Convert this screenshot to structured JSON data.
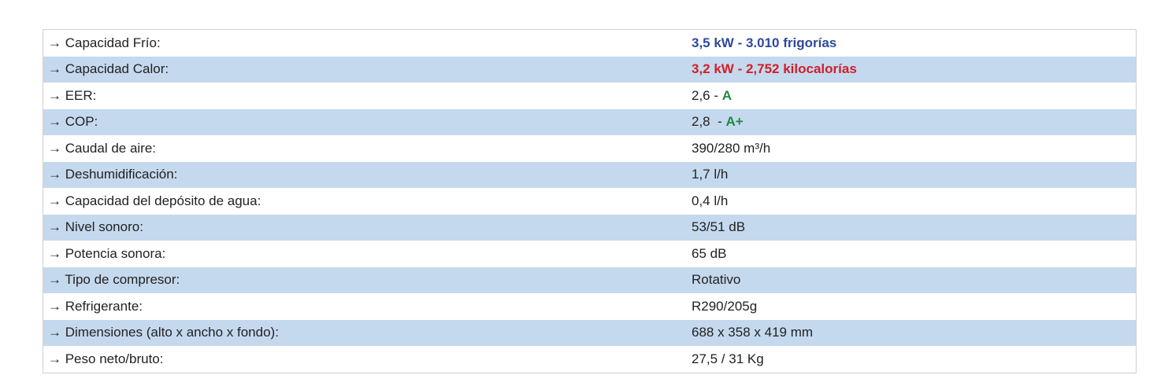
{
  "colors": {
    "blue": "#2f4a9a",
    "red": "#d01f2a",
    "green": "#1f8a45",
    "row_alt": "#c5d9ee"
  },
  "rows": [
    {
      "label": "→ Capacidad Frío:",
      "value": "3,5 kW - 3.010 frigorías"
    },
    {
      "label": "→ Capacidad Calor:",
      "value": "3,2 kW - 2,752 kilocalorías"
    },
    {
      "label": "→ EER:",
      "value": "2,6 - ",
      "rating": "A"
    },
    {
      "label": "→ COP:",
      "value": "2,8  - ",
      "rating": "A+"
    },
    {
      "label": "→ Caudal de aire:",
      "value": "390/280 m³/h"
    },
    {
      "label": "→ Deshumidificación:",
      "value": "1,7 l/h"
    },
    {
      "label": "→ Capacidad del depósito de agua:",
      "value": "0,4 l/h"
    },
    {
      "label": "→ Nivel sonoro:",
      "value": "53/51 dB"
    },
    {
      "label": "→ Potencia sonora:",
      "value": "65 dB"
    },
    {
      "label": "→ Tipo de compresor:",
      "value": "Rotativo"
    },
    {
      "label": "→ Refrigerante:",
      "value": "R290/205g"
    },
    {
      "label": "→ Dimensiones (alto x ancho x fondo):",
      "value": "688 x 358 x 419 mm"
    },
    {
      "label": "→ Peso neto/bruto:",
      "value": "27,5 / 31 Kg"
    }
  ]
}
